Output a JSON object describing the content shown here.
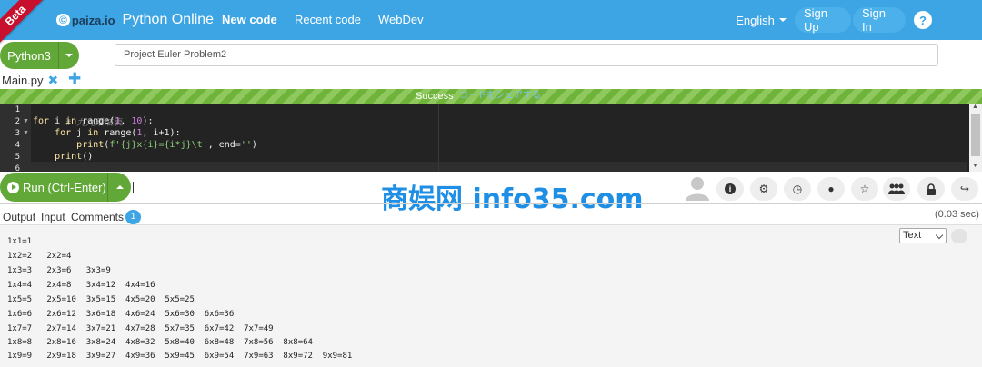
{
  "navbar": {
    "beta": "Beta",
    "logo_mark": "©",
    "logo_text": "paiza.io",
    "site_title": "Python Online",
    "links": [
      {
        "label": "New code"
      },
      {
        "label": "Recent code"
      },
      {
        "label": "WebDev"
      }
    ],
    "language": "English",
    "sign_up": "Sign Up",
    "sign_in": "Sign In",
    "help": "?"
  },
  "toolbar": {
    "language_button": "Python3",
    "project_title": "Project Euler Problem2"
  },
  "file_tabs": [
    {
      "name": "Main.py",
      "close": "✖"
    }
  ],
  "add_file": "✚",
  "status": {
    "text": "Success",
    "hint": "コードをシェアする"
  },
  "editor": {
    "line_numbers": [
      "1",
      "2",
      "3",
      "4",
      "5",
      "6"
    ]
  },
  "run": {
    "label": "Run (Ctrl-Enter)"
  },
  "tools": [
    {
      "icon": "info-icon",
      "glyph": "i"
    },
    {
      "icon": "gear-icon",
      "glyph": "⚙"
    },
    {
      "icon": "history-icon",
      "glyph": "◷"
    },
    {
      "icon": "github-icon",
      "glyph": "●"
    },
    {
      "icon": "star-icon",
      "glyph": "☆"
    },
    {
      "icon": "users-icon",
      "glyph": "👥"
    },
    {
      "icon": "lock-icon",
      "glyph": "🔒"
    },
    {
      "icon": "share-icon",
      "glyph": "↪"
    }
  ],
  "watermark": "商娱网 info35.com",
  "output_tabs": {
    "output": "Output",
    "input": "Input",
    "comments": "Comments",
    "comments_count": "1"
  },
  "elapsed": "(0.03 sec)",
  "output_format": "Text",
  "output_lines": [
    "1x1=1",
    "1x2=2   2x2=4",
    "1x3=3   2x3=6   3x3=9",
    "1x4=4   2x4=8   3x4=12  4x4=16",
    "1x5=5   2x5=10  3x5=15  4x5=20  5x5=25",
    "1x6=6   2x6=12  3x6=18  4x6=24  5x6=30  6x6=36",
    "1x7=7   2x7=14  3x7=21  4x7=28  5x7=35  6x7=42  7x7=49",
    "1x8=8   2x8=16  3x8=24  4x8=32  5x8=40  6x8=48  7x8=56  8x8=64",
    "1x9=9   2x9=18  3x9=27  4x9=36  5x9=45  6x9=54  7x9=63  8x9=72  9x9=81"
  ],
  "code": {
    "l1_comment": "# 九九乘法表",
    "l2_for": "for",
    "l2_var": " i ",
    "l2_in": "in",
    "l2_range": " range(",
    "l2_n1": "1",
    "l2_mid": ", ",
    "l2_n2": "10",
    "l2_end": "):",
    "l3_indent": "    ",
    "l3_for": "for",
    "l3_var": " j ",
    "l3_in": "in",
    "l3_range": " range(",
    "l3_n1": "1",
    "l3_end": ", i+1):",
    "l4_indent": "        ",
    "l4_print": "print",
    "l4_open": "(",
    "l4_str": "f'{j}x{i}={i*j}\\t'",
    "l4_mid": ", end=",
    "l4_str2": "''",
    "l4_end": ")",
    "l5_indent": "    ",
    "l5_print": "print",
    "l5_end": "()"
  }
}
